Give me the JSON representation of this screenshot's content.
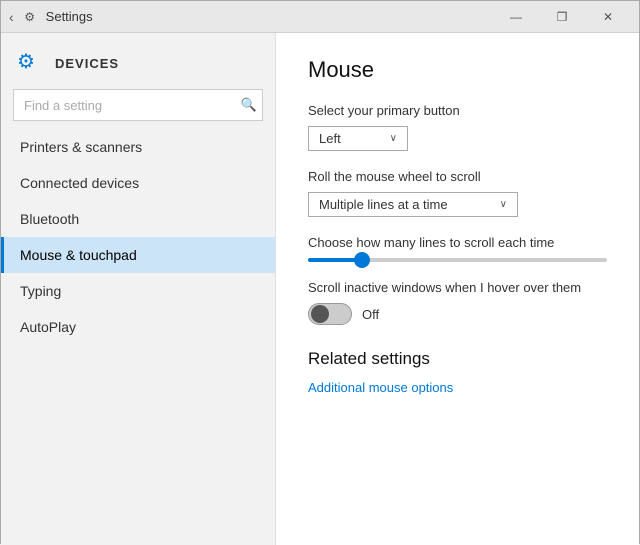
{
  "titlebar": {
    "title": "Settings",
    "back_label": "‹",
    "minimize": "—",
    "maximize": "❐",
    "close": "✕"
  },
  "sidebar": {
    "gear_icon": "⚙",
    "header": "DEVICES",
    "search_placeholder": "Find a setting",
    "search_icon": "🔍",
    "nav_items": [
      {
        "id": "printers",
        "label": "Printers & scanners"
      },
      {
        "id": "connected",
        "label": "Connected devices"
      },
      {
        "id": "bluetooth",
        "label": "Bluetooth"
      },
      {
        "id": "mouse",
        "label": "Mouse & touchpad",
        "active": true
      },
      {
        "id": "typing",
        "label": "Typing"
      },
      {
        "id": "autoplay",
        "label": "AutoPlay"
      }
    ]
  },
  "content": {
    "page_title": "Mouse",
    "primary_button_label": "Select your primary button",
    "primary_button_value": "Left",
    "primary_button_arrow": "∨",
    "scroll_label": "Roll the mouse wheel to scroll",
    "scroll_value": "Multiple lines at a time",
    "scroll_arrow": "∨",
    "lines_label": "Choose how many lines to scroll each time",
    "slider_percent": 18,
    "inactive_scroll_label": "Scroll inactive windows when I hover over them",
    "toggle_state": "Off",
    "related_title": "Related settings",
    "additional_link": "Additional mouse options"
  }
}
